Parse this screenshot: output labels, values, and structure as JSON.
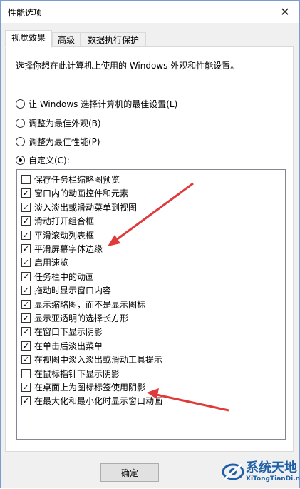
{
  "window": {
    "title": "性能选项"
  },
  "tabs": [
    {
      "label": "视觉效果",
      "active": true
    },
    {
      "label": "高级",
      "active": false
    },
    {
      "label": "数据执行保护",
      "active": false
    }
  ],
  "description": "选择你想在此计算机上使用的 Windows 外观和性能设置。",
  "radios": [
    {
      "label": "让 Windows 选择计算机的最佳设置(L)",
      "selected": false
    },
    {
      "label": "调整为最佳外观(B)",
      "selected": false
    },
    {
      "label": "调整为最佳性能(P)",
      "selected": false
    },
    {
      "label": "自定义(C):",
      "selected": true
    }
  ],
  "options": [
    {
      "label": "保存任务栏缩略图预览",
      "checked": false
    },
    {
      "label": "窗口内的动画控件和元素",
      "checked": true
    },
    {
      "label": "淡入淡出或滑动菜单到视图",
      "checked": true
    },
    {
      "label": "滑动打开组合框",
      "checked": true
    },
    {
      "label": "平滑滚动列表框",
      "checked": true
    },
    {
      "label": "平滑屏幕字体边缘",
      "checked": true
    },
    {
      "label": "启用速览",
      "checked": true
    },
    {
      "label": "任务栏中的动画",
      "checked": true
    },
    {
      "label": "拖动时显示窗口内容",
      "checked": true
    },
    {
      "label": "显示缩略图，而不是显示图标",
      "checked": true
    },
    {
      "label": "显示亚透明的选择长方形",
      "checked": true
    },
    {
      "label": "在窗口下显示阴影",
      "checked": true
    },
    {
      "label": "在单击后淡出菜单",
      "checked": true
    },
    {
      "label": "在视图中淡入淡出或滑动工具提示",
      "checked": true
    },
    {
      "label": "在鼠标指针下显示阴影",
      "checked": false
    },
    {
      "label": "在桌面上为图标标签使用阴影",
      "checked": true
    },
    {
      "label": "在最大化和最小化时显示窗口动画",
      "checked": true
    }
  ],
  "ok_label": "确定",
  "watermark": {
    "title": "系统天地",
    "subtitle": "XiTongTianDi.net"
  },
  "colors": {
    "arrow": "#e03a3a",
    "watermark": "#1f5fa8"
  }
}
